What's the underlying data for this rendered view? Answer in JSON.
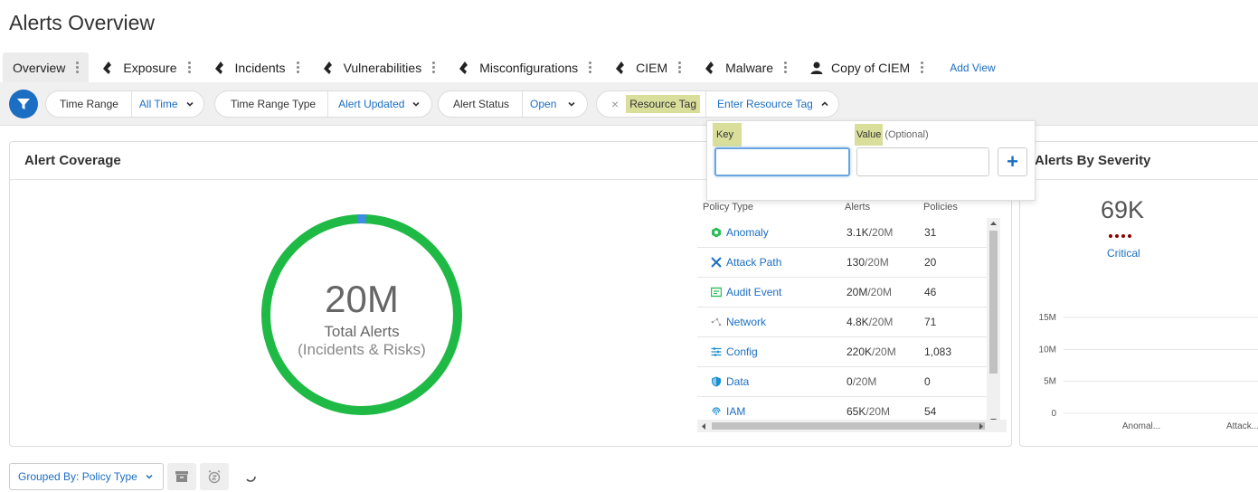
{
  "page": {
    "title": "Alerts Overview"
  },
  "tabs": [
    {
      "label": "Overview",
      "icon": "",
      "active": true
    },
    {
      "label": "Exposure",
      "icon": "prisma-icon"
    },
    {
      "label": "Incidents",
      "icon": "prisma-icon"
    },
    {
      "label": "Vulnerabilities",
      "icon": "prisma-icon"
    },
    {
      "label": "Misconfigurations",
      "icon": "prisma-icon"
    },
    {
      "label": "CIEM",
      "icon": "prisma-icon"
    },
    {
      "label": "Malware",
      "icon": "prisma-icon"
    },
    {
      "label": "Copy of CIEM",
      "icon": "user-icon"
    }
  ],
  "add_view_label": "Add View",
  "filters": {
    "time_range": {
      "label": "Time Range",
      "value": "All Time"
    },
    "time_range_type": {
      "label": "Time Range Type",
      "value": "Alert Updated"
    },
    "alert_status": {
      "label": "Alert Status",
      "value": "Open"
    },
    "resource_tag": {
      "remove_glyph": "×",
      "label": "Resource Tag",
      "placeholder": "Enter Resource Tag"
    }
  },
  "resource_tag_popover": {
    "key_label": "Key",
    "value_label": "Value",
    "value_optional": "(Optional)",
    "key_value": "",
    "value_value": "",
    "add_glyph": "+"
  },
  "coverage": {
    "title": "Alert Coverage",
    "total": "20M",
    "total_label": "Total Alerts",
    "total_sub": "(Incidents & Risks)",
    "colors": {
      "main": "#1fba45",
      "accent": "#3d8ee0"
    },
    "table": {
      "headers": {
        "policy_type": "Policy Type",
        "alerts": "Alerts",
        "policies": "Policies"
      },
      "rows": [
        {
          "name": "Anomaly",
          "icon": "anomaly-icon",
          "alerts": "3.1K",
          "den": "/20M",
          "policies": "31"
        },
        {
          "name": "Attack Path",
          "icon": "attack-path-icon",
          "alerts": "130",
          "den": "/20M",
          "policies": "20"
        },
        {
          "name": "Audit Event",
          "icon": "audit-event-icon",
          "alerts": "20M",
          "den": "/20M",
          "policies": "46"
        },
        {
          "name": "Network",
          "icon": "network-icon",
          "alerts": "4.8K",
          "den": "/20M",
          "policies": "71"
        },
        {
          "name": "Config",
          "icon": "config-icon",
          "alerts": "220K",
          "den": "/20M",
          "policies": "1,083"
        },
        {
          "name": "Data",
          "icon": "data-shield-icon",
          "alerts": "0",
          "den": "/20M",
          "policies": "0"
        },
        {
          "name": "IAM",
          "icon": "fingerprint-icon",
          "alerts": "65K",
          "den": "/20M",
          "policies": "54"
        }
      ]
    }
  },
  "severity": {
    "title": "Alerts By Severity",
    "critical_count": "69K",
    "critical_label": "Critical",
    "critical_color": "#8b0000",
    "chart_data": {
      "type": "bar",
      "categories": [
        "Anomal...",
        "Attack..."
      ],
      "ytick_labels": [
        "15M",
        "10M",
        "5M",
        "0"
      ],
      "ylim": [
        0,
        15000000
      ],
      "grid": true
    }
  },
  "bottom": {
    "grouped_by": "Grouped By: Policy Type"
  }
}
